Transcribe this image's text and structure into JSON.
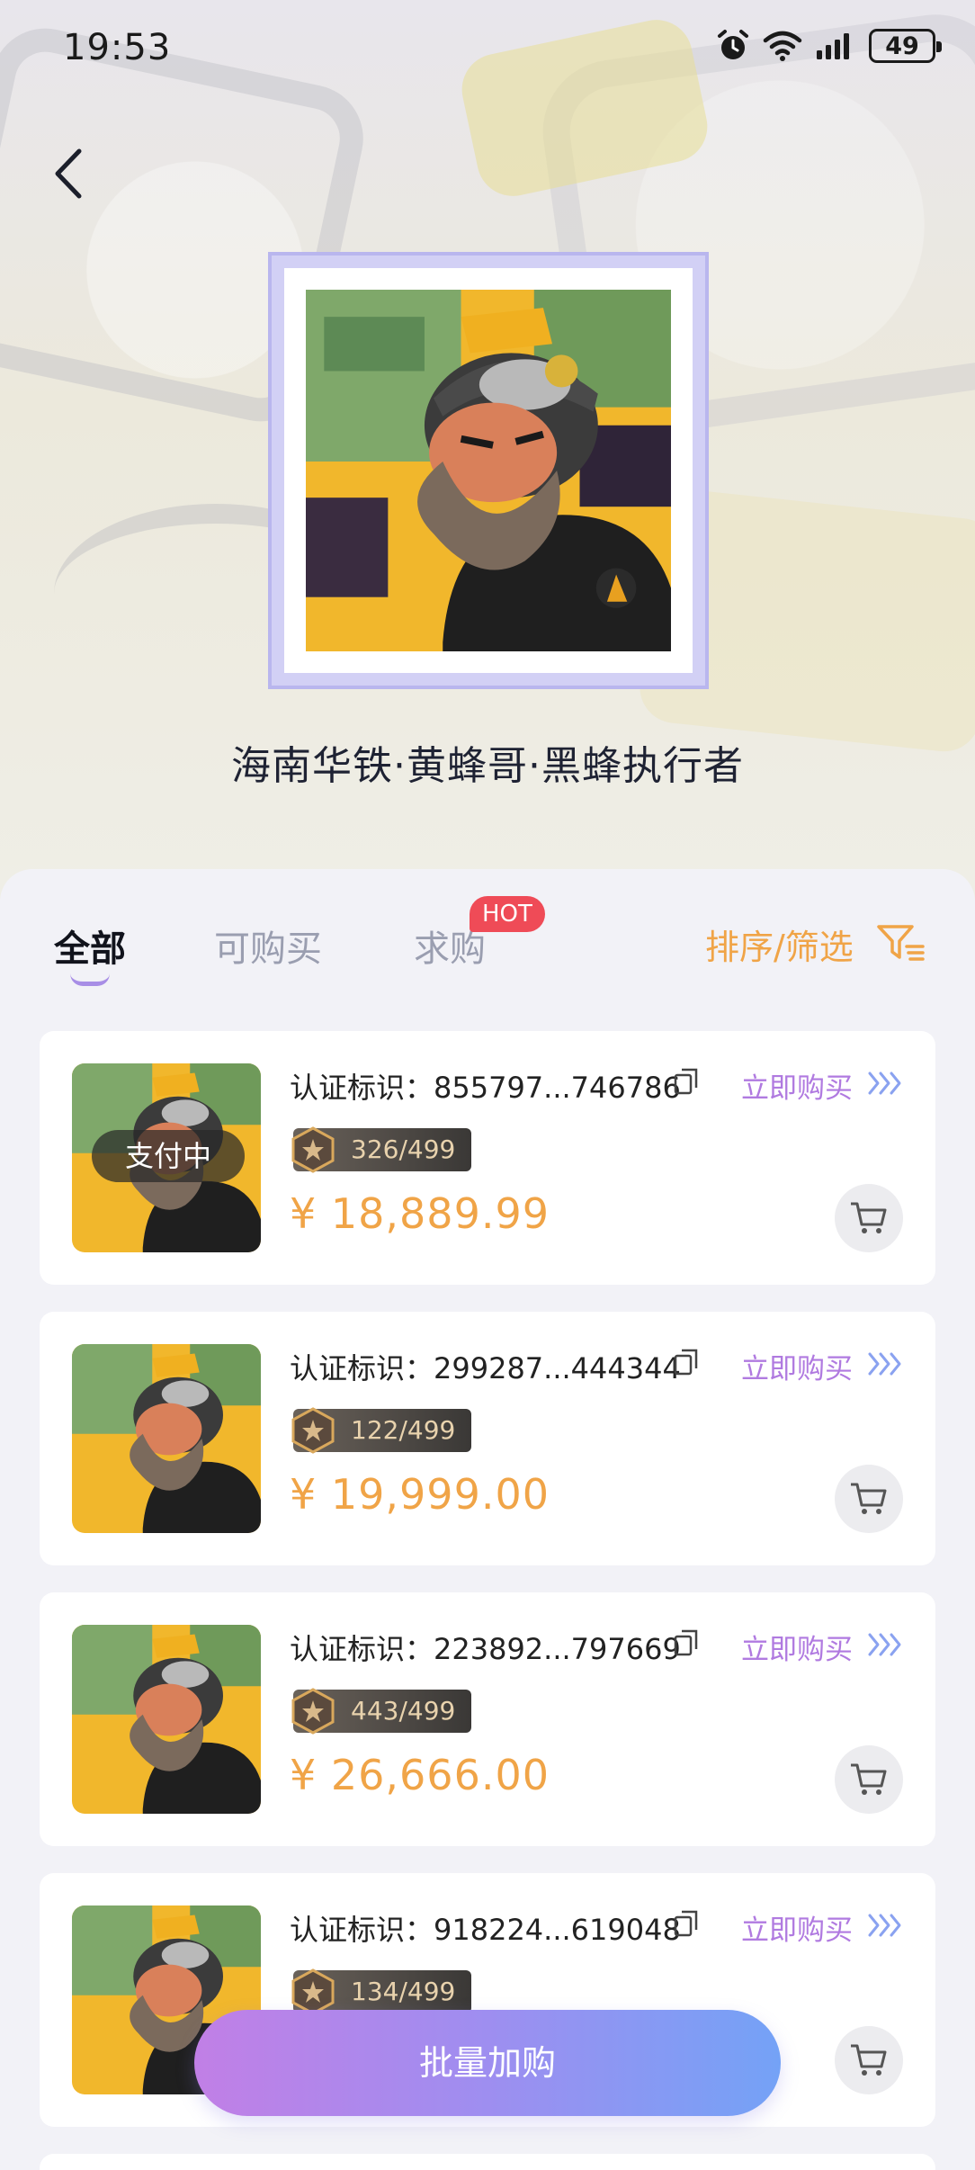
{
  "status_bar": {
    "time": "19:53",
    "battery": "49",
    "icons": [
      "alarm-icon",
      "wifi-icon",
      "signal-icon",
      "battery-icon"
    ]
  },
  "header": {
    "back_icon": "chevron-left-icon",
    "collection_title": "海南华铁·黄蜂哥·黑蜂执行者"
  },
  "tabs": {
    "all": "全部",
    "buyable": "可购买",
    "wanted": "求购",
    "hot_badge": "HOT",
    "sort_filter": "排序/筛选",
    "filter_icon": "filter-icon"
  },
  "colors": {
    "accent_orange": "#f0a447",
    "accent_purple": "#b07ae0",
    "hot_red": "#ef4b57",
    "button_gradient_start": "#c17fe6",
    "button_gradient_end": "#74a2f6"
  },
  "listings": [
    {
      "cert_label": "认证标识：855797...746786",
      "buy_now": "立即购买",
      "edition": "326/499",
      "price": "¥ 18,889.99",
      "overlay": "支付中"
    },
    {
      "cert_label": "认证标识：299287...444344",
      "buy_now": "立即购买",
      "edition": "122/499",
      "price": "¥ 19,999.00"
    },
    {
      "cert_label": "认证标识：223892...797669",
      "buy_now": "立即购买",
      "edition": "443/499",
      "price": "¥ 26,666.00"
    },
    {
      "cert_label": "认证标识：918224...619048",
      "buy_now": "立即购买",
      "edition": "134/499",
      "price": ""
    }
  ],
  "batch_button": "批量加购"
}
